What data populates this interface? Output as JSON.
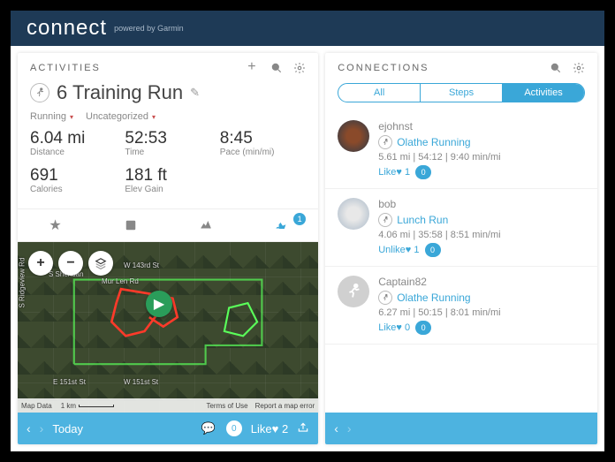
{
  "header": {
    "brand": "connect",
    "sub": "powered by Garmin"
  },
  "activities": {
    "panel_title": "ACTIVITIES",
    "title": "6 Training Run",
    "tag1": "Running",
    "tag2": "Uncategorized",
    "stats": {
      "distance_val": "6.04 mi",
      "distance_lbl": "Distance",
      "time_val": "52:53",
      "time_lbl": "Time",
      "pace_val": "8:45",
      "pace_lbl": "Pace (min/mi)",
      "calories_val": "691",
      "calories_lbl": "Calories",
      "elev_val": "181 ft",
      "elev_lbl": "Elev Gain"
    },
    "tab_badge": "1",
    "map": {
      "street1": "S Sheridan",
      "street2": "W 143rd St",
      "street3": "Mur Len Rd",
      "street4": "S Ridgeview Rd",
      "street5": "E 151st St",
      "street6": "W 151st St",
      "footer_data": "Map Data",
      "scale": "1 km",
      "terms": "Terms of Use",
      "report": "Report a map error"
    },
    "bottombar": {
      "today": "Today",
      "comments": "0",
      "like_label": "Like",
      "like_count": "2"
    }
  },
  "connections": {
    "panel_title": "CONNECTIONS",
    "seg_all": "All",
    "seg_steps": "Steps",
    "seg_activities": "Activities",
    "items": [
      {
        "name": "ejohnst",
        "activity": "Olathe Running",
        "stats": "5.61 mi | 54:12 | 9:40 min/mi",
        "like_label": "Like",
        "like_count": "1",
        "comments": "0"
      },
      {
        "name": "bob",
        "activity": "Lunch Run",
        "stats": "4.06 mi | 35:58 | 8:51 min/mi",
        "like_label": "Unlike",
        "like_count": "1",
        "comments": "0"
      },
      {
        "name": "Captain82",
        "activity": "Olathe Running",
        "stats": "6.27 mi | 50:15 | 8:01 min/mi",
        "like_label": "Like",
        "like_count": "0",
        "comments": "0"
      }
    ]
  }
}
